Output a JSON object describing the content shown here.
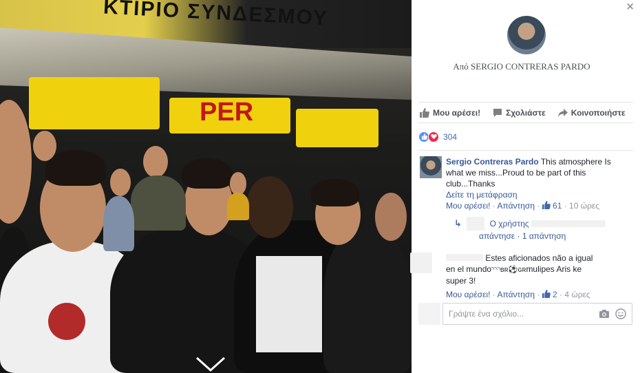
{
  "photo": {
    "banner_text": "ΚΤΙΡΙΟ ΣΥΝΔΕΣΜΟΥ",
    "flag_text": "PER",
    "next_icon": "chevron-down-icon"
  },
  "panel": {
    "close_label": "×",
    "by_line": "Από SERGIO CONTRERAS PARDO",
    "actions": {
      "like": "Μου αρέσει!",
      "comment": "Σχολιάστε",
      "share": "Κοινοποιήστε"
    },
    "reactions": {
      "count": "304"
    },
    "comments": [
      {
        "name": "Sergio Contreras Pardo",
        "text": "This atmosphere Is what we miss...Proud to be part of this club...Thanks",
        "translate": "Δείτε τη μετάφραση",
        "like": "Μου αρέσει!",
        "reply": "Απάντηση",
        "likes": "61",
        "time": "10 ώρες",
        "replies_text": "Ο χρήστης",
        "replies_suffix": "απάντησε",
        "replies_count": "1 απάντηση"
      },
      {
        "text_a": "Estes aficionados não a igual",
        "text_b": "en el mundo",
        "text_c": "mulipes Aris ke",
        "text_d": "super 3!",
        "like": "Μου αρέσει!",
        "reply": "Απάντηση",
        "likes": "2",
        "time": "4 ώρες"
      }
    ],
    "write_placeholder": "Γράψτε ένα σχόλιο..."
  },
  "colors": {
    "link": "#365899",
    "accent": "#4267b2",
    "muted": "#90949c",
    "love": "#f0284a"
  }
}
